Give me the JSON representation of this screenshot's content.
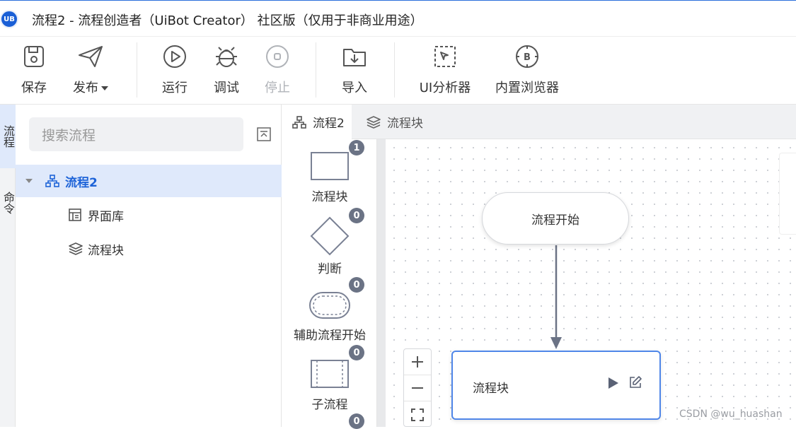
{
  "window": {
    "logo_text": "UB",
    "title": "流程2 - 流程创造者（UiBot Creator） 社区版（仅用于非商业用途）"
  },
  "toolbar": {
    "save": "保存",
    "publish": "发布",
    "run": "运行",
    "debug": "调试",
    "stop": "停止",
    "import": "导入",
    "ui_analyzer": "UI分析器",
    "browser": "内置浏览器"
  },
  "side_tabs": {
    "flow": "流程",
    "command": "命令"
  },
  "sidebar": {
    "search_placeholder": "搜索流程",
    "tree": {
      "root": "流程2",
      "children": [
        "界面库",
        "流程块"
      ]
    }
  },
  "tabs": {
    "flow2": "流程2",
    "flow_block": "流程块"
  },
  "palette": {
    "items": [
      {
        "label": "流程块",
        "count": "1"
      },
      {
        "label": "判断",
        "count": "0"
      },
      {
        "label": "辅助流程开始",
        "count": "0"
      },
      {
        "label": "子流程",
        "count": "0"
      },
      {
        "label": "",
        "count": "0"
      }
    ]
  },
  "canvas": {
    "start_node": "流程开始",
    "block_node": "流程块"
  },
  "watermark": "CSDN @wu_huashan",
  "colors": {
    "accent": "#1d63d8",
    "selection": "#dfe9fb",
    "badge": "#6b7385",
    "node_border": "#4f86e8"
  }
}
